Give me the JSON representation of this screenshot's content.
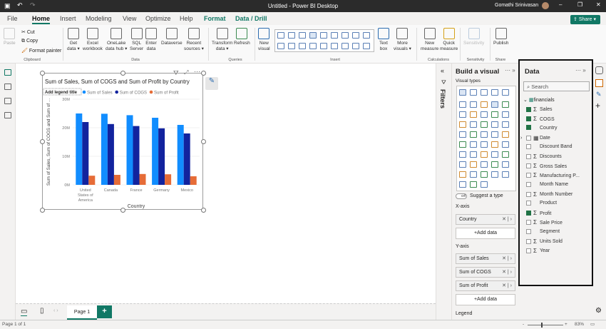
{
  "titlebar": {
    "title": "Untitled - Power BI Desktop",
    "user": "Gomathi Srinivasan"
  },
  "tabs": [
    "File",
    "Home",
    "Insert",
    "Modeling",
    "View",
    "Optimize",
    "Help",
    "Format",
    "Data / Drill"
  ],
  "share_label": "Share",
  "ribbon": {
    "paste": "Paste",
    "cut": "Cut",
    "copy": "Copy",
    "format_painter": "Format painter",
    "clipboard": "Clipboard",
    "data_buttons": [
      {
        "l1": "Get",
        "l2": "data ▾"
      },
      {
        "l1": "Excel",
        "l2": "workbook"
      },
      {
        "l1": "OneLake",
        "l2": "data hub ▾"
      },
      {
        "l1": "SQL",
        "l2": "Server"
      },
      {
        "l1": "Enter",
        "l2": "data"
      },
      {
        "l1": "Dataverse",
        "l2": ""
      },
      {
        "l1": "Recent",
        "l2": "sources ▾"
      }
    ],
    "data_group": "Data",
    "transform": {
      "l1": "Transform",
      "l2": "data ▾"
    },
    "refresh": "Refresh",
    "queries": "Queries",
    "new_visual": {
      "l1": "New",
      "l2": "visual"
    },
    "text_box": {
      "l1": "Text",
      "l2": "box"
    },
    "more_visuals": {
      "l1": "More",
      "l2": "visuals ▾"
    },
    "insert": "Insert",
    "new_measure": {
      "l1": "New",
      "l2": "measure"
    },
    "quick_measure": {
      "l1": "Quick",
      "l2": "measure"
    },
    "calculations": "Calculations",
    "sensitivity": "Sensitivity",
    "sensitivity_group": "Sensitivity",
    "publish": "Publish",
    "share_group": "Share"
  },
  "chart_data": {
    "type": "bar",
    "title": "Sum of Sales, Sum of COGS and Sum of Profit by Country",
    "legend_title": "Add legend title",
    "xlabel": "Country",
    "ylabel": "Sum of Sales, Sum of COGS and Sum of ...",
    "categories": [
      "United States of America",
      "Canada",
      "France",
      "Germany",
      "Mexico"
    ],
    "yticks": [
      "0M",
      "10M",
      "20M",
      "30M"
    ],
    "ylim": [
      0,
      30000000
    ],
    "legend_position": "top-left",
    "series": [
      {
        "name": "Sum of Sales",
        "color": "#118dff",
        "values": [
          25000000,
          24900000,
          24400000,
          23500000,
          21000000
        ]
      },
      {
        "name": "Sum of COGS",
        "color": "#12239e",
        "values": [
          22000000,
          21300000,
          20600000,
          19800000,
          18000000
        ]
      },
      {
        "name": "Sum of Profit",
        "color": "#e66c37",
        "values": [
          3200000,
          3500000,
          3800000,
          3700000,
          3000000
        ]
      }
    ]
  },
  "build": {
    "title": "Build a visual",
    "visual_types": "Visual types",
    "suggest": "Suggest a type",
    "toggle": "Off",
    "xaxis": "X-axis",
    "xfields": [
      "Country"
    ],
    "yaxis": "Y-axis",
    "yfields": [
      "Sum of Sales",
      "Sum of COGS",
      "Sum of Profit"
    ],
    "add_data": "+Add data",
    "legend": "Legend"
  },
  "filters_label": "Filters",
  "data_pane": {
    "title": "Data",
    "search_placeholder": "Search",
    "table": "financials",
    "fields": [
      {
        "name": "Sales",
        "sigma": true,
        "checked": true
      },
      {
        "name": "COGS",
        "sigma": true,
        "checked": true
      },
      {
        "name": "Country",
        "sigma": false,
        "checked": true
      },
      {
        "name": "Date",
        "sigma": false,
        "checked": false,
        "date": true
      },
      {
        "name": "Discount Band",
        "sigma": false,
        "checked": false
      },
      {
        "name": "Discounts",
        "sigma": true,
        "checked": false
      },
      {
        "name": "Gross Sales",
        "sigma": true,
        "checked": false
      },
      {
        "name": "Manufacturing P...",
        "sigma": true,
        "checked": false
      },
      {
        "name": "Month Name",
        "sigma": false,
        "checked": false
      },
      {
        "name": "Month Number",
        "sigma": true,
        "checked": false
      },
      {
        "name": "Product",
        "sigma": false,
        "checked": false
      },
      {
        "name": "Profit",
        "sigma": true,
        "checked": true
      },
      {
        "name": "Sale Price",
        "sigma": true,
        "checked": false
      },
      {
        "name": "Segment",
        "sigma": false,
        "checked": false
      },
      {
        "name": "Units Sold",
        "sigma": true,
        "checked": false
      },
      {
        "name": "Year",
        "sigma": true,
        "checked": false
      }
    ]
  },
  "pages": {
    "tabs": [
      "Page 1"
    ],
    "add": "+"
  },
  "status": {
    "page": "Page 1 of 1",
    "zoom": "83%"
  }
}
